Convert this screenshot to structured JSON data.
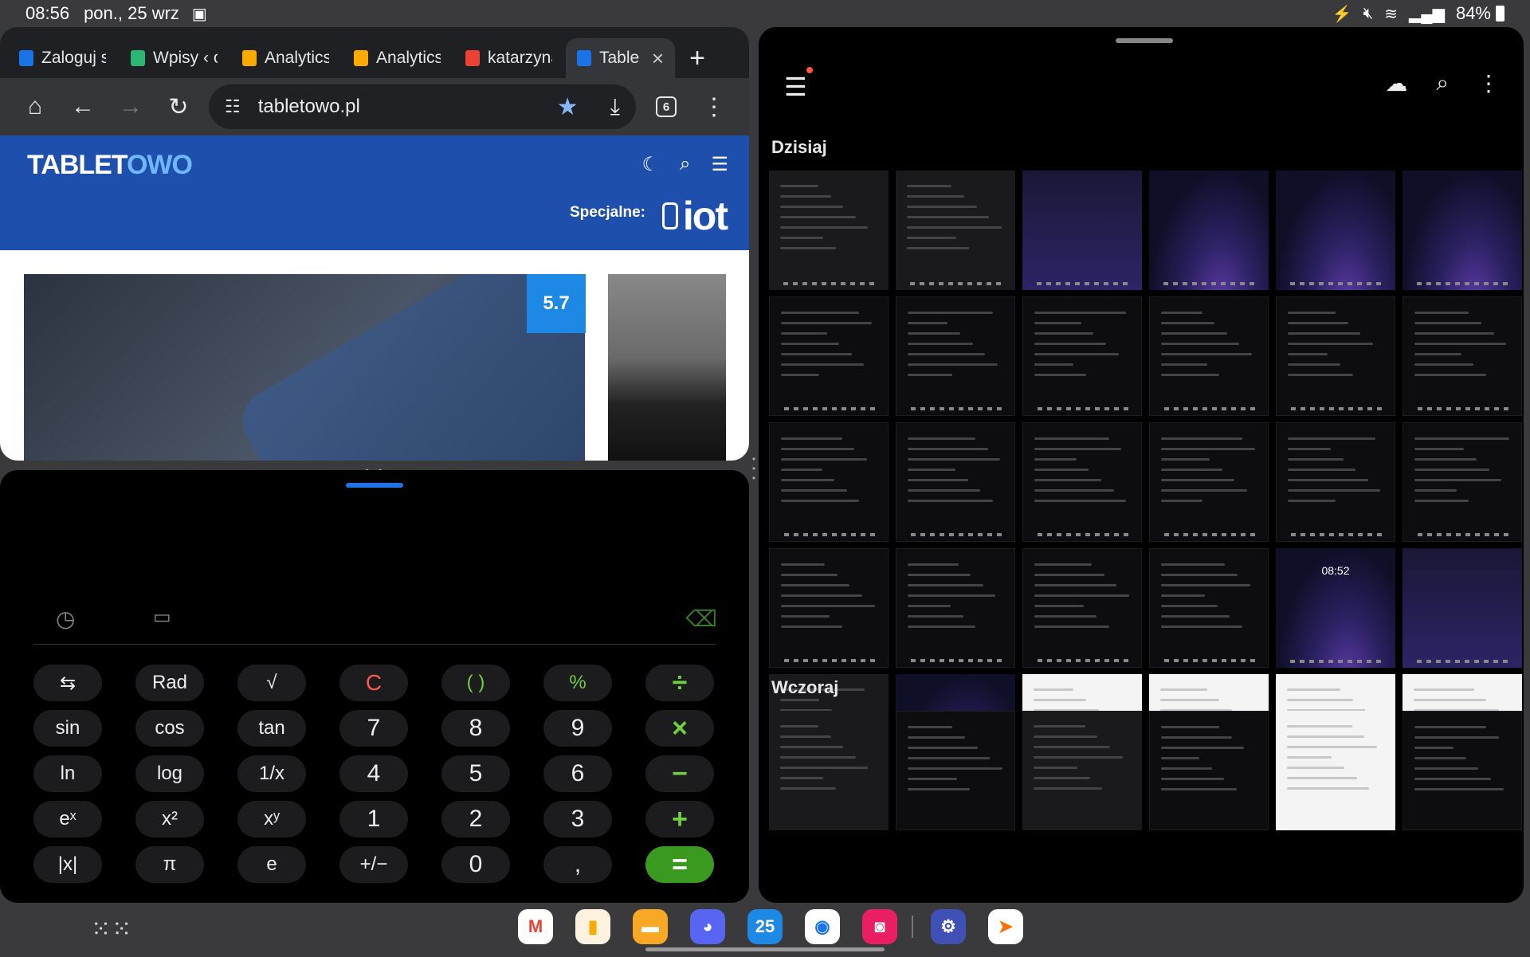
{
  "status": {
    "time": "08:56",
    "date": "pon., 25 wrz",
    "battery": "84%"
  },
  "browser": {
    "tabs": [
      {
        "label": "Zaloguj s",
        "color": "#1a73e8"
      },
      {
        "label": "Wpisy ‹ o",
        "color": "#2bb673"
      },
      {
        "label": "Analytics",
        "color": "#f9ab00"
      },
      {
        "label": "Analytics",
        "color": "#f9ab00"
      },
      {
        "label": "katarzyna",
        "color": "#ea4335"
      },
      {
        "label": "Table",
        "color": "#1a73e8",
        "active": true
      }
    ],
    "new_tab": "+",
    "url": "tabletowo.pl",
    "tab_count": "6"
  },
  "site": {
    "logo_main": "TABLET",
    "logo_accent": "OWO",
    "special_label": "Specjalne:",
    "special_brand": "iot",
    "score": "5.7"
  },
  "calculator": {
    "rows": [
      [
        {
          "l": "⇆"
        },
        {
          "l": "Rad"
        },
        {
          "l": "√"
        },
        {
          "l": "C",
          "t": "clr"
        },
        {
          "l": "( )",
          "t": "op2"
        },
        {
          "l": "%",
          "t": "op2"
        },
        {
          "l": "÷",
          "t": "op"
        }
      ],
      [
        {
          "l": "sin"
        },
        {
          "l": "cos"
        },
        {
          "l": "tan"
        },
        {
          "l": "7",
          "t": "big"
        },
        {
          "l": "8",
          "t": "big"
        },
        {
          "l": "9",
          "t": "big"
        },
        {
          "l": "×",
          "t": "op"
        }
      ],
      [
        {
          "l": "ln"
        },
        {
          "l": "log"
        },
        {
          "l": "1/x"
        },
        {
          "l": "4",
          "t": "big"
        },
        {
          "l": "5",
          "t": "big"
        },
        {
          "l": "6",
          "t": "big"
        },
        {
          "l": "−",
          "t": "op"
        }
      ],
      [
        {
          "l": "eˣ"
        },
        {
          "l": "x²"
        },
        {
          "l": "xʸ"
        },
        {
          "l": "1",
          "t": "big"
        },
        {
          "l": "2",
          "t": "big"
        },
        {
          "l": "3",
          "t": "big"
        },
        {
          "l": "+",
          "t": "op"
        }
      ],
      [
        {
          "l": "|x|"
        },
        {
          "l": "π"
        },
        {
          "l": "e"
        },
        {
          "l": "+/−"
        },
        {
          "l": "0",
          "t": "big"
        },
        {
          "l": ",",
          "t": "big"
        },
        {
          "l": "=",
          "t": "eq"
        }
      ]
    ]
  },
  "gallery": {
    "section_today": "Dzisiaj",
    "section_yesterday": "Wczoraj",
    "today_thumbs": [
      "shot",
      "shot",
      "home",
      "purple",
      "purple",
      "purple",
      "dark",
      "dark",
      "dark",
      "dark",
      "dark",
      "dark",
      "dark",
      "dark",
      "dark",
      "dark",
      "dark",
      "dark",
      "dark",
      "dark",
      "dark",
      "dark",
      "purple",
      "home",
      "shot",
      "purple",
      "white",
      "white",
      "white",
      "white"
    ],
    "clock_text": "08:52",
    "yesterday_thumbs": [
      "shot",
      "dark",
      "shot",
      "dark",
      "white",
      "dark"
    ]
  },
  "dock": {
    "calendar_day": "25",
    "apps": [
      {
        "name": "gmail",
        "color": "#ffffff",
        "glyph": "M",
        "fg": "#ea4335"
      },
      {
        "name": "analytics",
        "color": "#fff3e0",
        "glyph": "▮",
        "fg": "#f9ab00"
      },
      {
        "name": "files",
        "color": "#f9a825",
        "glyph": "▬",
        "fg": "#fff"
      },
      {
        "name": "discord",
        "color": "#5865f2",
        "glyph": "◕",
        "fg": "#fff"
      },
      {
        "name": "calendar",
        "color": "#1e88e5",
        "glyph": "25",
        "fg": "#fff"
      },
      {
        "name": "chrome",
        "color": "#ffffff",
        "glyph": "◉",
        "fg": "#1a73e8"
      },
      {
        "name": "screen-recorder",
        "color": "#e91e63",
        "glyph": "◙",
        "fg": "#fff"
      },
      {
        "name": "settings",
        "color": "#3f51b5",
        "glyph": "⚙",
        "fg": "#fff"
      },
      {
        "name": "swift",
        "color": "#ffffff",
        "glyph": "➤",
        "fg": "#ff6f00"
      }
    ]
  }
}
